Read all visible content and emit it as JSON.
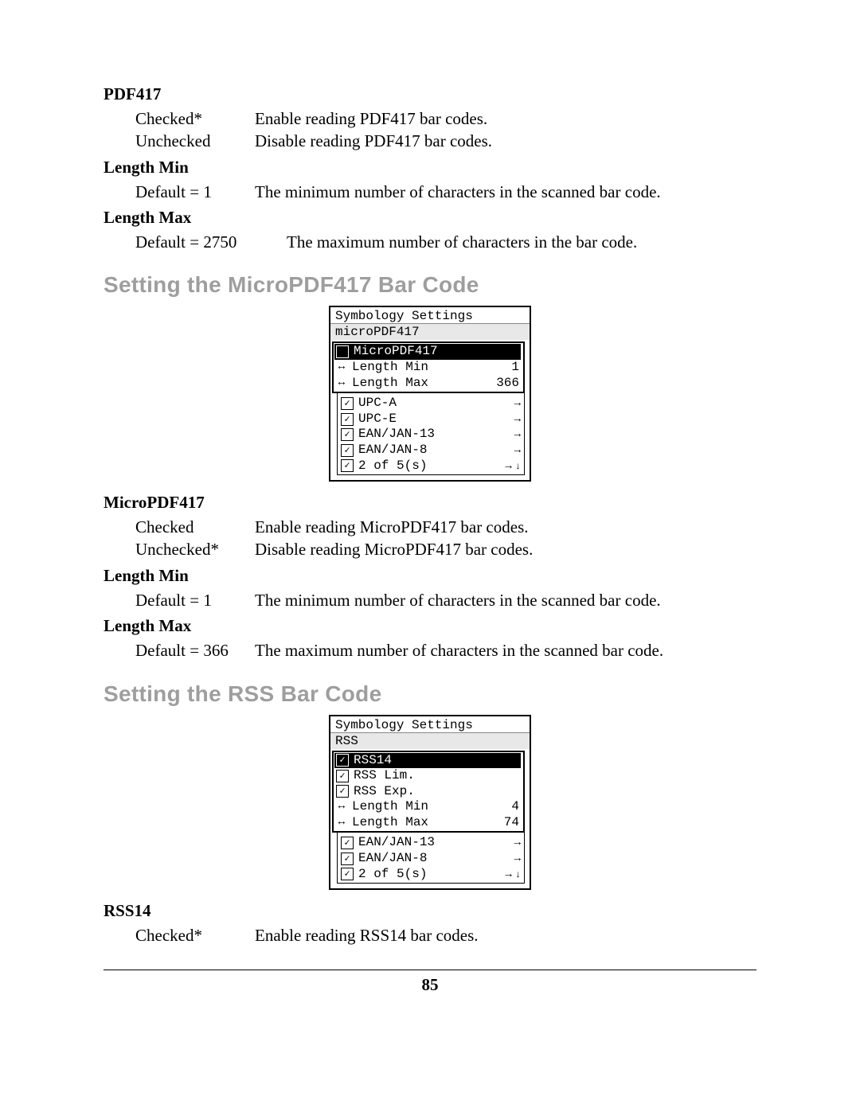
{
  "pdf417": {
    "name": "PDF417",
    "checked_label": "Checked*",
    "checked_desc": "Enable reading PDF417 bar codes.",
    "unchecked_label": "Unchecked",
    "unchecked_desc": "Disable reading PDF417 bar codes.",
    "len_min_name": "Length Min",
    "len_min_label": "Default = 1",
    "len_min_desc": "The minimum number of characters in the scanned bar code.",
    "len_max_name": "Length Max",
    "len_max_label": "Default = 2750",
    "len_max_desc": "The maximum number of characters in the bar code."
  },
  "micro": {
    "section": "Setting the MicroPDF417 Bar Code",
    "fig": {
      "title": "Symbology Settings",
      "sub": "microPDF417",
      "r0": "MicroPDF417",
      "r1": "Length Min",
      "r1v": "1",
      "r2": "Length Max",
      "r2v": "366",
      "l0": "UPC-A",
      "l1": "UPC-E",
      "l2": "EAN/JAN-13",
      "l3": "EAN/JAN-8",
      "l4": "2 of 5(s)"
    },
    "name": "MicroPDF417",
    "checked_label": "Checked",
    "checked_desc": "Enable reading MicroPDF417 bar codes.",
    "unchecked_label": "Unchecked*",
    "unchecked_desc": "Disable reading MicroPDF417 bar codes.",
    "len_min_name": "Length Min",
    "len_min_label": "Default = 1",
    "len_min_desc": "The minimum number of characters in the scanned bar code.",
    "len_max_name": "Length Max",
    "len_max_label": "Default = 366",
    "len_max_desc": "The maximum number of characters in the scanned bar code."
  },
  "rss": {
    "section": "Setting the RSS Bar Code",
    "fig": {
      "title": "Symbology Settings",
      "sub": "RSS",
      "r0": "RSS14",
      "r1": "RSS Lim.",
      "r2": "RSS Exp.",
      "r3": "Length Min",
      "r3v": "4",
      "r4": "Length Max",
      "r4v": "74",
      "l0": "EAN/JAN-13",
      "l1": "EAN/JAN-8",
      "l2": "2 of 5(s)"
    },
    "name": "RSS14",
    "checked_label": "Checked*",
    "checked_desc": "Enable reading RSS14 bar codes."
  },
  "page_number": "85"
}
